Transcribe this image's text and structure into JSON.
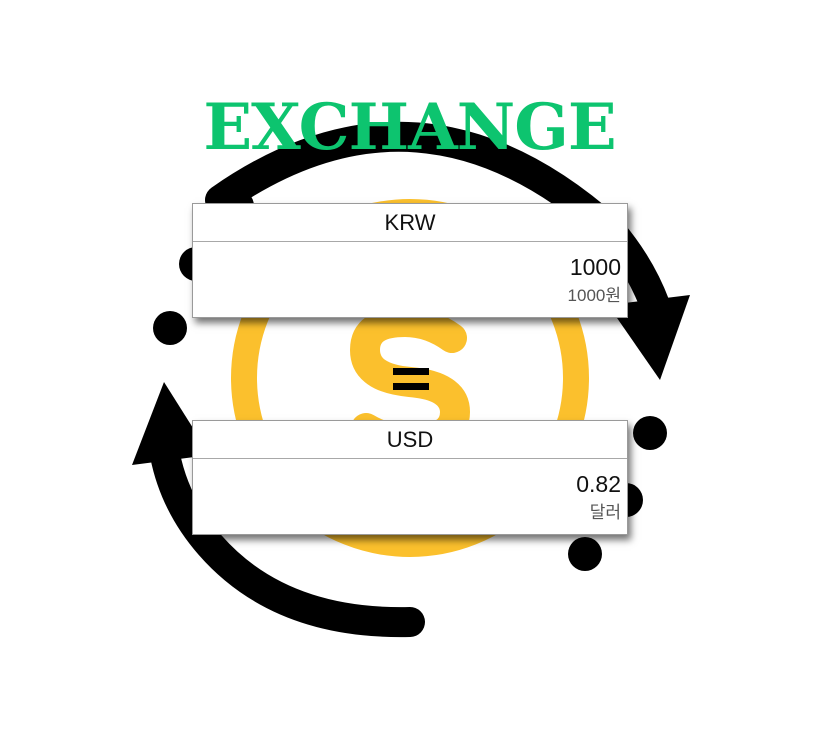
{
  "title": "EXCHANGE",
  "colors": {
    "title": "#0dc46f",
    "coin": "#fbc02d",
    "arrows": "#000000"
  },
  "icons": {
    "background": "exchange-arrows-coin-icon",
    "operator": "equals-icon"
  },
  "from": {
    "currency": "KRW",
    "value": "1000",
    "formatted": "1000원"
  },
  "to": {
    "currency": "USD",
    "value": "0.82",
    "formatted": "달러"
  }
}
